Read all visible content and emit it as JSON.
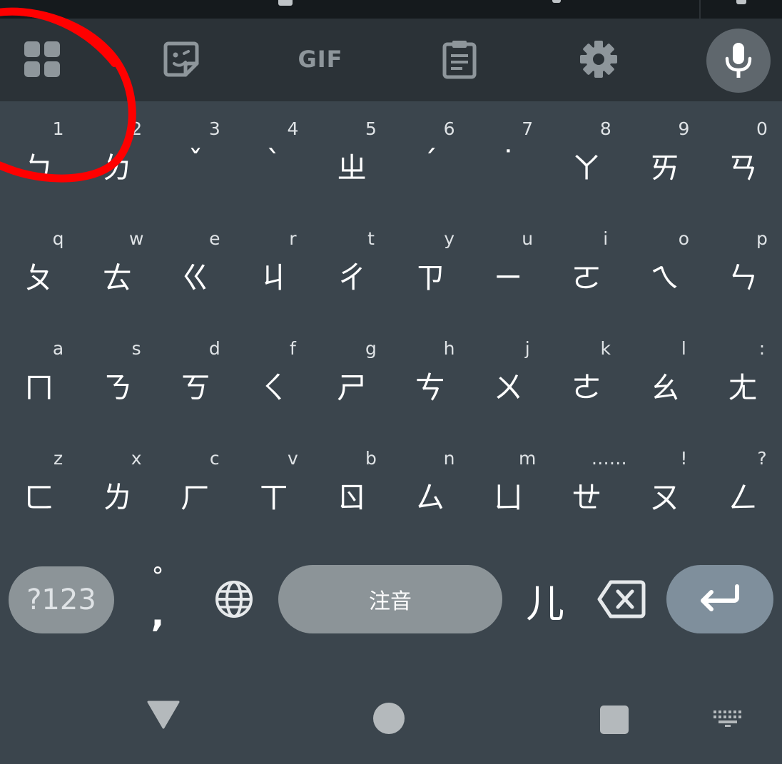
{
  "toolbar": {
    "icons": [
      "grid-apps-icon",
      "sticker-icon",
      "gif-icon",
      "clipboard-icon",
      "gear-icon",
      "microphone-icon"
    ],
    "gif_label": "GIF"
  },
  "keyboard": {
    "rows": [
      {
        "keys": [
          {
            "hint": "1",
            "main": "ㄅ"
          },
          {
            "hint": "2",
            "main": "ㄉ"
          },
          {
            "hint": "3",
            "main": "ˇ"
          },
          {
            "hint": "4",
            "main": "ˋ"
          },
          {
            "hint": "5",
            "main": "ㄓ"
          },
          {
            "hint": "6",
            "main": "ˊ"
          },
          {
            "hint": "7",
            "main": "˙"
          },
          {
            "hint": "8",
            "main": "ㄚ"
          },
          {
            "hint": "9",
            "main": "ㄞ"
          },
          {
            "hint": "0",
            "main": "ㄢ"
          }
        ]
      },
      {
        "keys": [
          {
            "hint": "q",
            "main": "ㄆ"
          },
          {
            "hint": "w",
            "main": "ㄊ"
          },
          {
            "hint": "e",
            "main": "ㄍ"
          },
          {
            "hint": "r",
            "main": "ㄐ"
          },
          {
            "hint": "t",
            "main": "ㄔ"
          },
          {
            "hint": "y",
            "main": "ㄗ"
          },
          {
            "hint": "u",
            "main": "ㄧ"
          },
          {
            "hint": "i",
            "main": "ㄛ"
          },
          {
            "hint": "o",
            "main": "ㄟ"
          },
          {
            "hint": "p",
            "main": "ㄣ"
          }
        ]
      },
      {
        "keys": [
          {
            "hint": "a",
            "main": "ㄇ"
          },
          {
            "hint": "s",
            "main": "ㄋ"
          },
          {
            "hint": "d",
            "main": "ㄎ"
          },
          {
            "hint": "f",
            "main": "ㄑ"
          },
          {
            "hint": "g",
            "main": "ㄕ"
          },
          {
            "hint": "h",
            "main": "ㄘ"
          },
          {
            "hint": "j",
            "main": "ㄨ"
          },
          {
            "hint": "k",
            "main": "ㄜ"
          },
          {
            "hint": "l",
            "main": "ㄠ"
          },
          {
            "hint": ":",
            "main": "ㄤ"
          }
        ]
      },
      {
        "keys": [
          {
            "hint": "z",
            "main": "ㄈ"
          },
          {
            "hint": "x",
            "main": "ㄌ"
          },
          {
            "hint": "c",
            "main": "ㄏ"
          },
          {
            "hint": "v",
            "main": "ㄒ"
          },
          {
            "hint": "b",
            "main": "ㄖ"
          },
          {
            "hint": "n",
            "main": "ㄙ"
          },
          {
            "hint": "m",
            "main": "ㄩ"
          },
          {
            "hint": "……",
            "main": "ㄝ"
          },
          {
            "hint": "!",
            "main": "ㄡ"
          },
          {
            "hint": "?",
            "main": "ㄥ"
          }
        ]
      }
    ]
  },
  "bottom_row": {
    "symbols_label": "?123",
    "punct_top": "°",
    "punct_bottom": ",",
    "space_label": "注音",
    "er_label": "儿"
  },
  "navbar": {
    "icons": [
      "back-triangle-icon",
      "home-circle-icon",
      "recents-square-icon",
      "keyboard-switch-icon"
    ]
  },
  "colors": {
    "keyboard_bg": "#3b454d",
    "toolbar_bg": "#2b3237",
    "status_bg": "#151a1d",
    "pill_gray": "#8c9498",
    "enter_blue": "#7f8f9c",
    "annotation_red": "#ff0000"
  }
}
